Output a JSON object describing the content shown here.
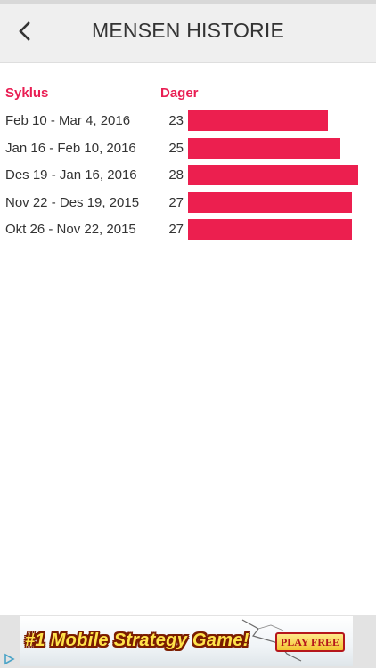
{
  "header": {
    "title": "MENSEN HISTORIE",
    "back_icon": "chevron-left-icon"
  },
  "table": {
    "col_cycle": "Syklus",
    "col_days": "Dager",
    "max_days": 28,
    "accent_color": "#e91e53",
    "bar_color": "#ec1f4f",
    "rows": [
      {
        "range": "Feb 10 - Mar 4, 2016",
        "days": "23",
        "value": 23
      },
      {
        "range": "Jan 16 - Feb 10, 2016",
        "days": "25",
        "value": 25
      },
      {
        "range": "Des 19 - Jan 16, 2016",
        "days": "28",
        "value": 28
      },
      {
        "range": "Nov 22 - Des 19, 2015",
        "days": "27",
        "value": 27
      },
      {
        "range": "Okt 26 - Nov 22, 2015",
        "days": "27",
        "value": 27
      }
    ]
  },
  "ad": {
    "headline": "#1 Mobile Strategy Game!",
    "cta": "PLAY FREE",
    "choices_icon": "ad-choices-icon"
  }
}
